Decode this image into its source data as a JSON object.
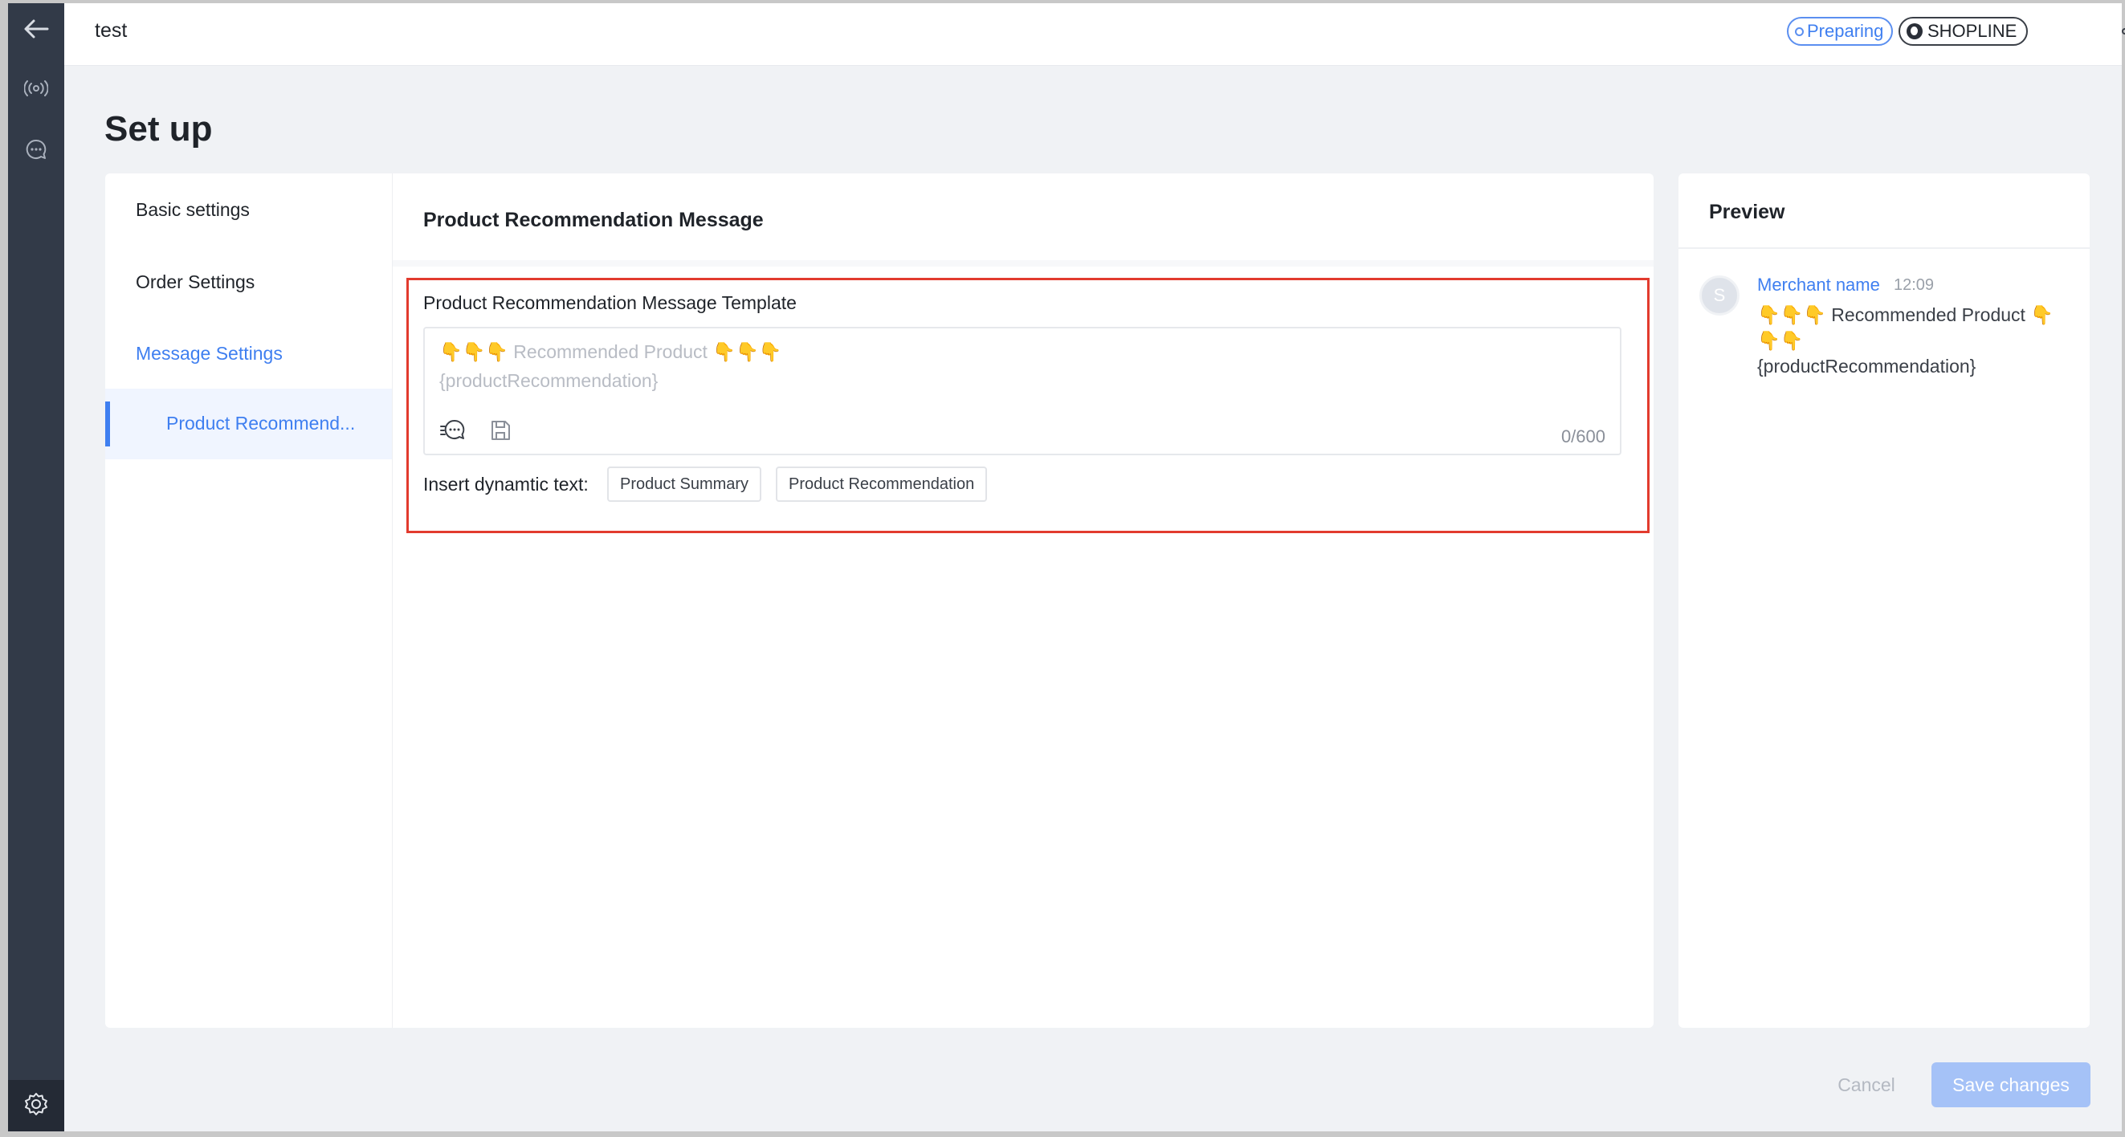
{
  "header": {
    "title": "test",
    "status": "Preparing",
    "brand": "SHOPLINE"
  },
  "rail": {
    "icons": [
      "back-arrow-icon",
      "broadcast-icon",
      "chat-icon",
      "settings-icon"
    ]
  },
  "page": {
    "title": "Set up"
  },
  "nav": {
    "items": [
      {
        "label": "Basic settings",
        "active": false
      },
      {
        "label": "Order Settings",
        "active": false
      },
      {
        "label": "Message Settings",
        "active": true
      }
    ],
    "sub_item": "Product Recommend..."
  },
  "content": {
    "heading": "Product Recommendation Message",
    "template_label": "Product Recommendation Message Template",
    "placeholder_line1_emoji_left": "👇👇👇",
    "placeholder_line1_text": " Recommended Product ",
    "placeholder_line1_emoji_right": "👇👇👇",
    "placeholder_line2": "{productRecommendation}",
    "counter": "0/600",
    "insert_label": "Insert dynamtic text:",
    "chips": [
      "Product Summary",
      "Product Recommendation"
    ]
  },
  "preview": {
    "title": "Preview",
    "avatar_letter": "S",
    "merchant_name": "Merchant name",
    "time": "12:09",
    "message_line1_emoji_left": "👇👇👇",
    "message_line1_text": " Recommended Product ",
    "message_line1_emoji_right": "👇👇👇",
    "message_line2": "{productRecommendation}"
  },
  "footer": {
    "cancel_label": "Cancel",
    "save_label": "Save changes"
  },
  "colors": {
    "accent": "#3f7ff0",
    "rail": "#323a48",
    "highlight": "#e23b2e",
    "save_disabled": "#a5c2f7"
  }
}
